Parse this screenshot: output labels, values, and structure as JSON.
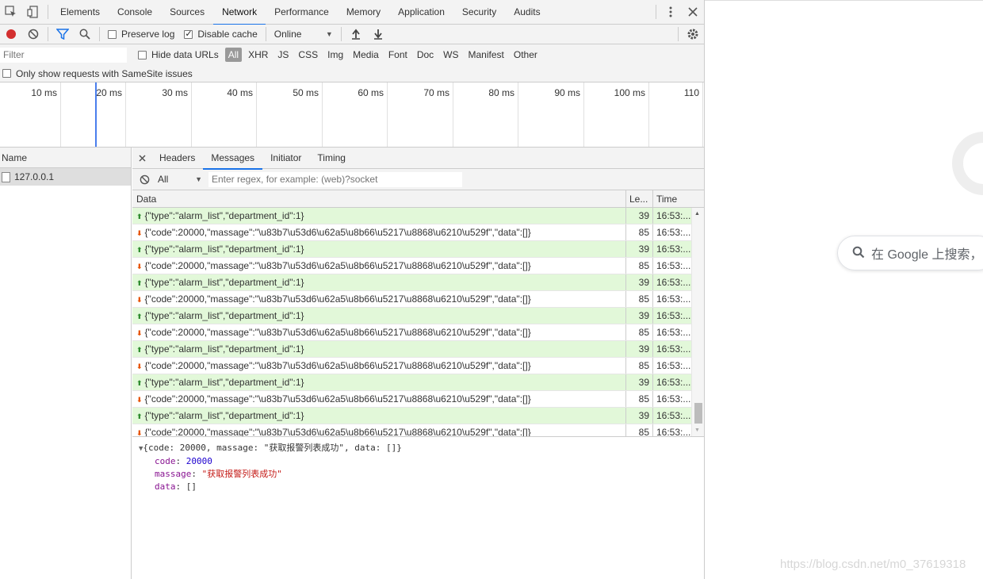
{
  "devtools": {
    "tabs": [
      "Elements",
      "Console",
      "Sources",
      "Network",
      "Performance",
      "Memory",
      "Application",
      "Security",
      "Audits"
    ],
    "active_tab": "Network",
    "toolbar": {
      "preserve_log": "Preserve log",
      "disable_cache": "Disable cache",
      "throttle": "Online"
    },
    "filter": {
      "placeholder": "Filter",
      "hide_data_urls": "Hide data URLs",
      "types": [
        "All",
        "XHR",
        "JS",
        "CSS",
        "Img",
        "Media",
        "Font",
        "Doc",
        "WS",
        "Manifest",
        "Other"
      ],
      "samesite": "Only show requests with SameSite issues"
    },
    "overview_ticks": [
      "10 ms",
      "20 ms",
      "30 ms",
      "40 ms",
      "50 ms",
      "60 ms",
      "70 ms",
      "80 ms",
      "90 ms",
      "100 ms",
      "110"
    ],
    "requests": {
      "header": "Name",
      "items": [
        "127.0.0.1"
      ]
    },
    "detail_tabs": [
      "Headers",
      "Messages",
      "Initiator",
      "Timing"
    ],
    "active_detail_tab": "Messages",
    "messages_filter": {
      "type": "All",
      "placeholder": "Enter regex, for example: (web)?socket"
    },
    "table": {
      "headers": [
        "Data",
        "Le...",
        "Time"
      ],
      "rows": [
        {
          "dir": "sent",
          "data": "{\"type\":\"alarm_list\",\"department_id\":1}",
          "len": "39",
          "time": "16:53:..."
        },
        {
          "dir": "recv",
          "data": "{\"code\":20000,\"massage\":\"\\u83b7\\u53d6\\u62a5\\u8b66\\u5217\\u8868\\u6210\\u529f\",\"data\":[]}",
          "len": "85",
          "time": "16:53:..."
        },
        {
          "dir": "sent",
          "data": "{\"type\":\"alarm_list\",\"department_id\":1}",
          "len": "39",
          "time": "16:53:..."
        },
        {
          "dir": "recv",
          "data": "{\"code\":20000,\"massage\":\"\\u83b7\\u53d6\\u62a5\\u8b66\\u5217\\u8868\\u6210\\u529f\",\"data\":[]}",
          "len": "85",
          "time": "16:53:..."
        },
        {
          "dir": "sent",
          "data": "{\"type\":\"alarm_list\",\"department_id\":1}",
          "len": "39",
          "time": "16:53:..."
        },
        {
          "dir": "recv",
          "data": "{\"code\":20000,\"massage\":\"\\u83b7\\u53d6\\u62a5\\u8b66\\u5217\\u8868\\u6210\\u529f\",\"data\":[]}",
          "len": "85",
          "time": "16:53:..."
        },
        {
          "dir": "sent",
          "data": "{\"type\":\"alarm_list\",\"department_id\":1}",
          "len": "39",
          "time": "16:53:..."
        },
        {
          "dir": "recv",
          "data": "{\"code\":20000,\"massage\":\"\\u83b7\\u53d6\\u62a5\\u8b66\\u5217\\u8868\\u6210\\u529f\",\"data\":[]}",
          "len": "85",
          "time": "16:53:..."
        },
        {
          "dir": "sent",
          "data": "{\"type\":\"alarm_list\",\"department_id\":1}",
          "len": "39",
          "time": "16:53:..."
        },
        {
          "dir": "recv",
          "data": "{\"code\":20000,\"massage\":\"\\u83b7\\u53d6\\u62a5\\u8b66\\u5217\\u8868\\u6210\\u529f\",\"data\":[]}",
          "len": "85",
          "time": "16:53:..."
        },
        {
          "dir": "sent",
          "data": "{\"type\":\"alarm_list\",\"department_id\":1}",
          "len": "39",
          "time": "16:53:..."
        },
        {
          "dir": "recv",
          "data": "{\"code\":20000,\"massage\":\"\\u83b7\\u53d6\\u62a5\\u8b66\\u5217\\u8868\\u6210\\u529f\",\"data\":[]}",
          "len": "85",
          "time": "16:53:..."
        },
        {
          "dir": "sent",
          "data": "{\"type\":\"alarm_list\",\"department_id\":1}",
          "len": "39",
          "time": "16:53:..."
        },
        {
          "dir": "recv",
          "data": "{\"code\":20000,\"massage\":\"\\u83b7\\u53d6\\u62a5\\u8b66\\u5217\\u8868\\u6210\\u529f\",\"data\":[]}",
          "len": "85",
          "time": "16:53:..."
        }
      ]
    },
    "detail": {
      "summary": "{code: 20000, massage: \"获取报警列表成功\", data: []}",
      "props": [
        {
          "key": "code",
          "value": "20000",
          "kind": "num"
        },
        {
          "key": "massage",
          "value": "\"获取报警列表成功\"",
          "kind": "str"
        },
        {
          "key": "data",
          "value": "[]",
          "kind": "plain"
        }
      ]
    }
  },
  "google": {
    "search_placeholder": "在 Google 上搜索，",
    "watermark": "https://blog.csdn.net/m0_37619318"
  },
  "colors": {
    "accent": "#1a73e8",
    "sent_row": "#e2f8d9",
    "record_red": "#d32f2f"
  }
}
